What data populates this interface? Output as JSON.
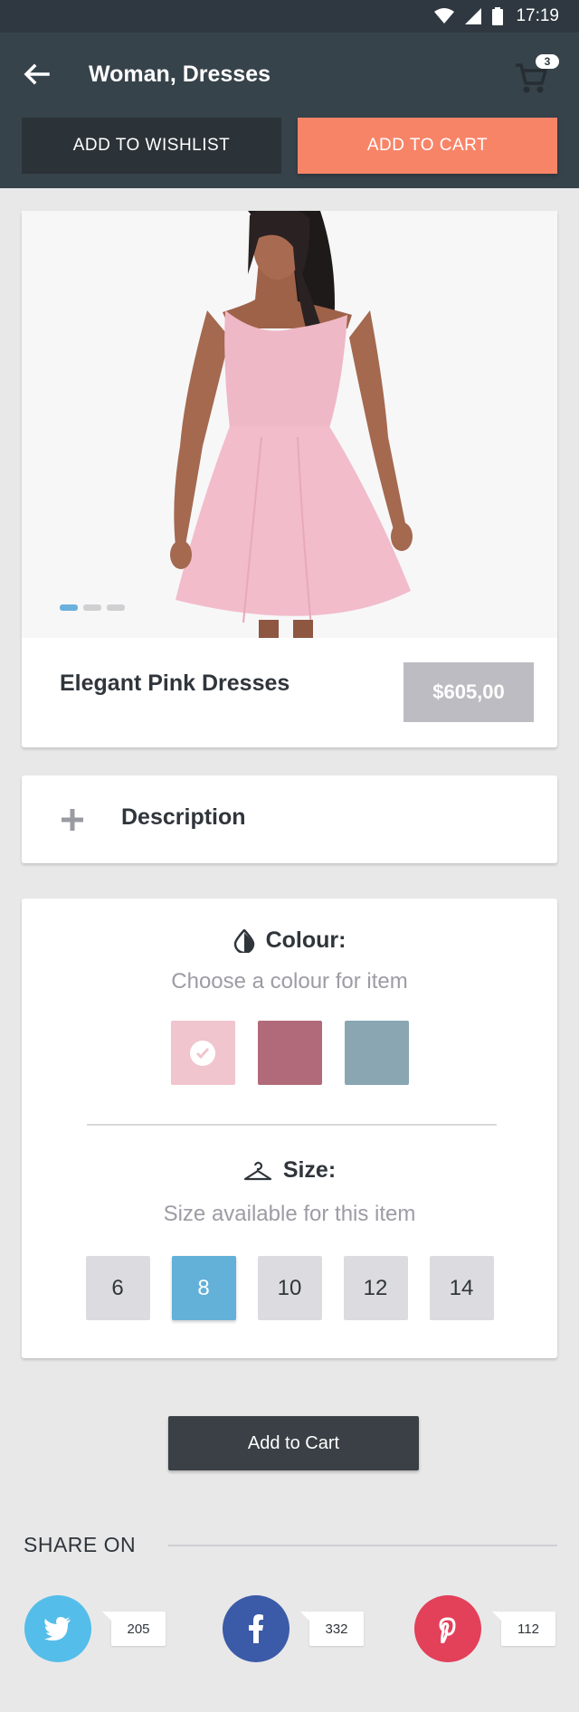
{
  "status_bar": {
    "time": "17:19"
  },
  "header": {
    "title": "Woman, Dresses",
    "cart_count": "3",
    "wishlist_label": "ADD TO WISHLIST",
    "add_to_cart_label": "ADD TO CART"
  },
  "product": {
    "name": "Elegant Pink Dresses",
    "price": "$605,00",
    "gallery_active_index": 0,
    "gallery_count": 3
  },
  "description": {
    "label": "Description"
  },
  "colour": {
    "title": "Colour:",
    "subtitle": "Choose a colour for item",
    "options": [
      {
        "color": "#f0c5cd",
        "selected": true
      },
      {
        "color": "#b16a79",
        "selected": false
      },
      {
        "color": "#89a6b2",
        "selected": false
      }
    ]
  },
  "size": {
    "title": "Size:",
    "subtitle": "Size available for this item",
    "options": [
      "6",
      "8",
      "10",
      "12",
      "14"
    ],
    "selected": "8"
  },
  "actions": {
    "add_to_cart": "Add to Cart"
  },
  "share": {
    "title": "SHARE ON",
    "items": [
      {
        "network": "twitter",
        "icon": "twitter-icon",
        "color": "#55bde9",
        "count": "205"
      },
      {
        "network": "facebook",
        "icon": "facebook-icon",
        "color": "#3b5ba8",
        "count": "332"
      },
      {
        "network": "pinterest",
        "icon": "pinterest-icon",
        "color": "#e3405a",
        "count": "112"
      }
    ]
  }
}
